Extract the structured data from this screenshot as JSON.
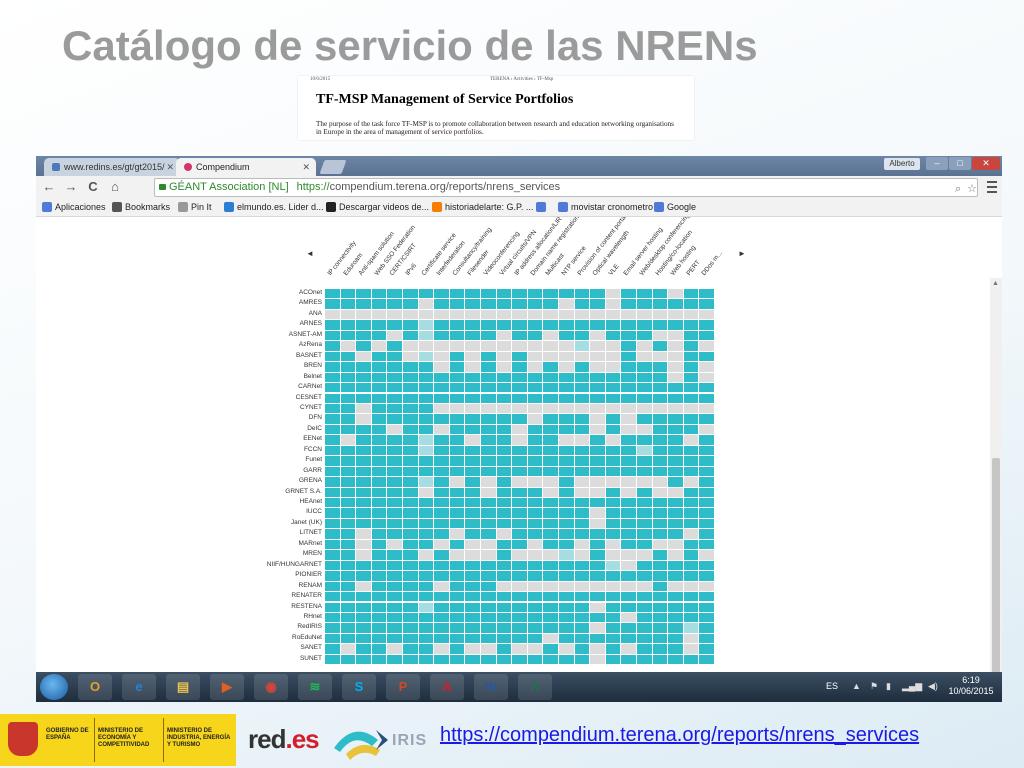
{
  "slide": {
    "title": "Catálogo de servicio de las NRENs",
    "footer_url": "https://compendium.terena.org/reports/nrens_services"
  },
  "doc_snippet": {
    "date": "10/6/2015",
    "crumb": "TERENA › Activities › TF-Msp",
    "heading": "TF-MSP Management of Service Portfolios",
    "body": "The purpose of the task force TF-MSP is to promote collaboration between research and education networking organisations in Europe in the area of management of service portfolios."
  },
  "browser": {
    "tabs": [
      {
        "label": "www.redins.es/gt/gt2015/",
        "active": false
      },
      {
        "label": "Compendium",
        "active": true
      }
    ],
    "user": "Alberto",
    "window_controls": {
      "minimize": "–",
      "maximize": "□",
      "close": "✕"
    },
    "nav": {
      "back": "←",
      "forward": "→",
      "reload": "C",
      "home": "⌂"
    },
    "ev_label": "GÉANT Association [NL]",
    "url_scheme": "https://",
    "url_rest": "compendium.terena.org/reports/nrens_services",
    "bookmarks": [
      {
        "label": "Aplicaciones",
        "icon": "apps-grid-icon",
        "color": "#4f7ad8"
      },
      {
        "label": "Bookmarks",
        "icon": "star-icon",
        "color": "#555555"
      },
      {
        "label": "Pin It",
        "icon": "page-icon",
        "color": "#999999"
      },
      {
        "label": "elmundo.es. Lider d...",
        "icon": "globe-icon",
        "color": "#2a7fd4"
      },
      {
        "label": "Descargar videos de...",
        "icon": "d-icon",
        "color": "#222222"
      },
      {
        "label": "historiadelarte: G.P. ...",
        "icon": "blogger-icon",
        "color": "#f57d00"
      },
      {
        "label": "",
        "icon": "google-icon",
        "color": "#4f7ad8"
      },
      {
        "label": "movistar cronometro",
        "icon": "google-icon",
        "color": "#4f7ad8"
      },
      {
        "label": "Google",
        "icon": "google-icon",
        "color": "#4f7ad8"
      }
    ]
  },
  "matrix": {
    "columns": [
      "IP connectivity",
      "Eduroam",
      "Anti-spam solution",
      "Web SSO Federation",
      "CERT/CSIRT",
      "IPv6",
      "Certificate service",
      "Interfederation",
      "Consultancy/training",
      "Filesender",
      "Videoconferencing",
      "Virtual circuits/VPN",
      "IP address allocation/LIR",
      "Domain name registration",
      "Multicast",
      "NTP service",
      "Provision of content portals",
      "Optical wavelength",
      "VLE",
      "Email server hosting",
      "Web/desktop conferencing",
      "Hosting/co-location",
      "Web hosting",
      "PERT",
      "DDos m..."
    ],
    "rows": [
      "ACOnet",
      "AMRES",
      "ANA",
      "ARNES",
      "ASNET-AM",
      "AzRena",
      "BASNET",
      "BREN",
      "Belnet",
      "CARNet",
      "CESNET",
      "CYNET",
      "DFN",
      "DeIC",
      "EENet",
      "FCCN",
      "Funet",
      "GARR",
      "GRENA",
      "GRNET S.A.",
      "HEAnet",
      "IUCC",
      "Janet (UK)",
      "LITNET",
      "MARnet",
      "MREN",
      "NIIF/HUNGARNET",
      "PIONIER",
      "RENAM",
      "RENATER",
      "RESTENA",
      "RHnet",
      "RedIRIS",
      "RoEduNet",
      "SANET",
      "SUNET"
    ],
    "cells": [
      "1111111111111111110111011",
      "1111110111111110110111111",
      "0000000000000000000000000",
      "1111112111111111111111111",
      "1111012111101101101110011",
      "1010100000000000200101010",
      "1101102010101000000100011",
      "1111111010101010100111010",
      "1111111111111111111111010",
      "1111111111111111111111111",
      "1111111111111111111111111",
      "1101111000000000000000000",
      "1101111111111011101011111",
      "1111011011110111101001110",
      "1011112110110110010111101",
      "1111112111111111111121111",
      "1111111111111111111111111",
      "1111111111111111111111111",
      "1111112101010001000000101",
      "1111110111011101001010011",
      "1111111111111111111111111",
      "1111111111111111101111111",
      "1111111111111111101111111",
      "1101111101101111111111101",
      "1101011010011011010110011",
      "1101110100010002010001010",
      "1111111111111111112011111",
      "1111111111111111111111111",
      "1101111011100000000001000",
      "1111111111111111111111111",
      "1111112111111111101111111",
      "1111111111111111111011111",
      "1111111111111111101111121",
      "1111111111111101111111101",
      "1011011010010010101011101",
      "1111111111111111101111111"
    ],
    "colors": {
      "yes": "#2ebcc9",
      "no": "#dcdcdc",
      "partial": "#a6dde3"
    },
    "nav_left": "◄",
    "nav_right": "►"
  },
  "taskbar": {
    "apps": [
      {
        "name": "outlook",
        "glyph": "O",
        "color": "#e8a020"
      },
      {
        "name": "internet-explorer",
        "glyph": "e",
        "color": "#2a7fd4"
      },
      {
        "name": "file-explorer",
        "glyph": "▤",
        "color": "#e8c050"
      },
      {
        "name": "media-player",
        "glyph": "▶",
        "color": "#e06020"
      },
      {
        "name": "chrome",
        "glyph": "◉",
        "color": "#d9443a"
      },
      {
        "name": "spotify",
        "glyph": "≋",
        "color": "#1db954"
      },
      {
        "name": "skype",
        "glyph": "S",
        "color": "#00aff0"
      },
      {
        "name": "powerpoint",
        "glyph": "P",
        "color": "#d24726"
      },
      {
        "name": "acrobat",
        "glyph": "A",
        "color": "#d31e2b"
      },
      {
        "name": "word",
        "glyph": "W",
        "color": "#2b579a"
      },
      {
        "name": "excel",
        "glyph": "X",
        "color": "#217346"
      }
    ],
    "lang": "ES",
    "time": "6:19",
    "date": "10/06/2015"
  },
  "footer": {
    "gov_1": "GOBIERNO DE ESPAÑA",
    "gov_2": "MINISTERIO DE ECONOMÍA Y COMPETITIVIDAD",
    "gov_3": "MINISTERIO DE INDUSTRIA, ENERGÍA Y TURISMO",
    "redes_a": "red",
    "redes_b": ".es",
    "iris": "IRIS"
  }
}
